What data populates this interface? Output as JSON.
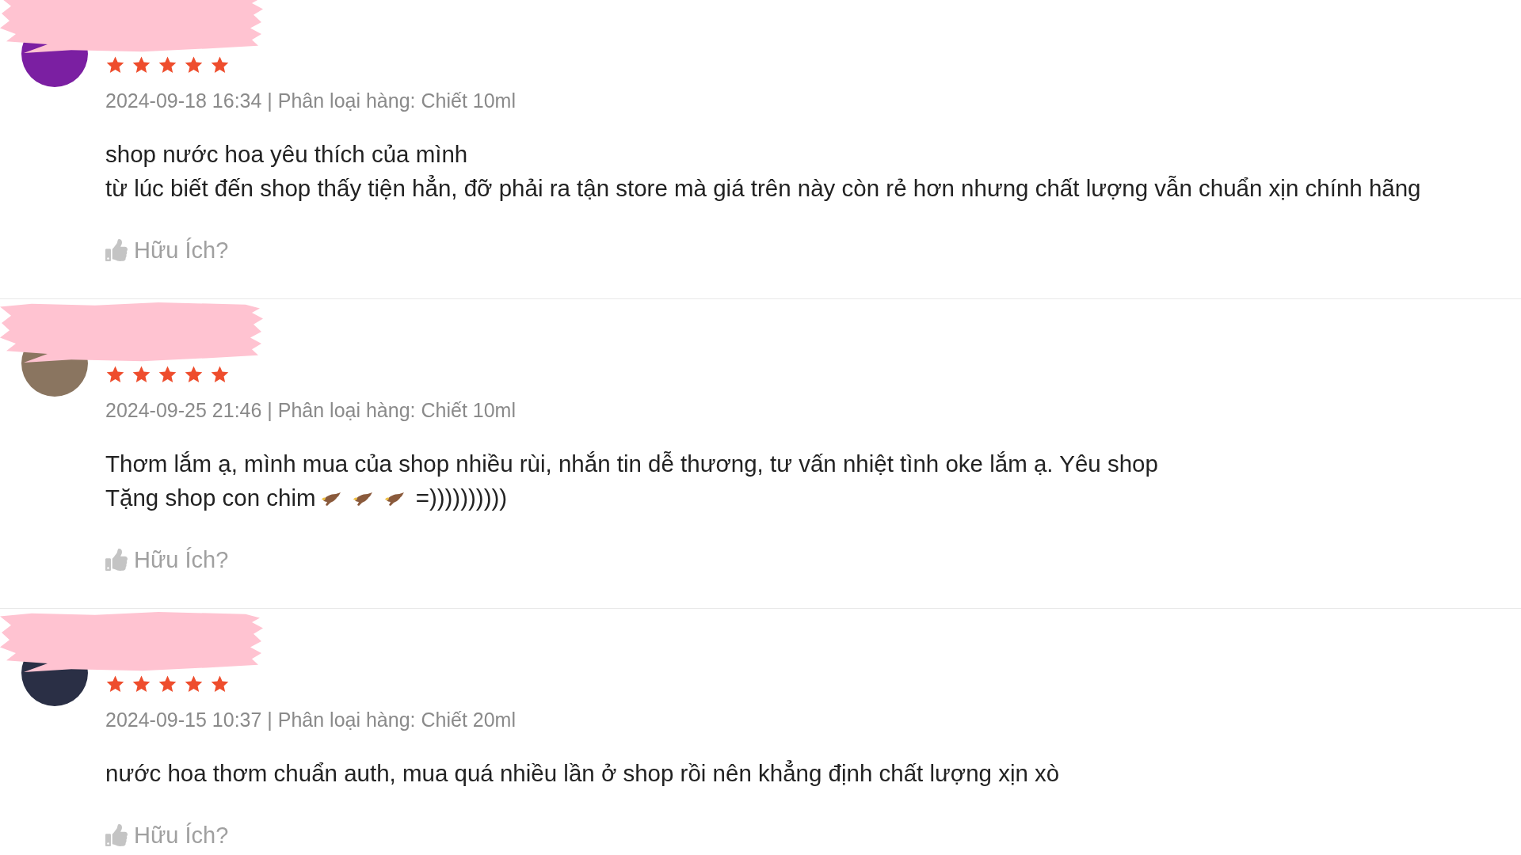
{
  "reviews": [
    {
      "avatar": {
        "color": "#7b1fa2"
      },
      "stars": 5,
      "meta": "2024-09-18 16:34 | Phân loại hàng: Chiết 10ml",
      "comment_lines": [
        [
          {
            "kind": "text",
            "text": "shop nước hoa yêu thích của mình"
          }
        ],
        [
          {
            "kind": "text",
            "text": "từ lúc biết đến shop thấy tiện hẳn, đỡ phải ra tận store mà giá trên này còn rẻ hơn nhưng chất lượng vẫn chuẩn xịn chính hãng"
          }
        ]
      ],
      "helpful": "Hữu Ích?"
    },
    {
      "avatar": {
        "color": "#8a7560"
      },
      "stars": 5,
      "meta": "2024-09-25 21:46 | Phân loại hàng: Chiết 10ml",
      "comment_lines": [
        [
          {
            "kind": "text",
            "text": "Thơm lắm ạ, mình mua của shop nhiều rùi, nhắn tin dễ thương, tư vấn nhiệt tình oke lắm ạ. Yêu shop"
          }
        ],
        [
          {
            "kind": "text",
            "text": "Tặng shop con chim"
          },
          {
            "kind": "bird"
          },
          {
            "kind": "bird"
          },
          {
            "kind": "bird"
          },
          {
            "kind": "text",
            "text": "=))))))))))"
          }
        ]
      ],
      "helpful": "Hữu Ích?"
    },
    {
      "avatar": {
        "color": "#2a2f45"
      },
      "stars": 5,
      "meta": "2024-09-15 10:37 | Phân loại hàng: Chiết 20ml",
      "comment_lines": [
        [
          {
            "kind": "text",
            "text": "nước hoa thơm chuẩn auth, mua quá nhiều lần ở shop rồi nên khẳng định chất lượng xịn xò"
          }
        ]
      ],
      "helpful": "Hữu Ích?"
    }
  ]
}
